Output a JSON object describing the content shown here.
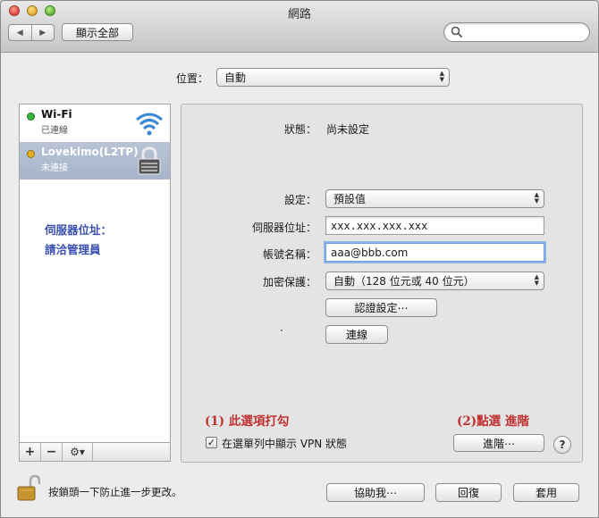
{
  "window": {
    "title": "網路"
  },
  "toolbar": {
    "back_glyph": "◀",
    "forward_glyph": "▶",
    "show_all_label": "顯示全部",
    "search_placeholder": ""
  },
  "location": {
    "label": "位置：",
    "value": "自動"
  },
  "services": [
    {
      "name": "Wi-Fi",
      "status": "已連線",
      "status_color": "#3cb43c",
      "icon": "wifi-icon"
    },
    {
      "name": "Lovekimo(L2TP)",
      "status": "未連接",
      "status_color": "#e0b020",
      "icon": "vpn-lock-icon",
      "selected": true
    }
  ],
  "sidebar_note": {
    "line1": "伺服器位址：",
    "line2": "請洽管理員"
  },
  "sidebar_toolbar": {
    "add": "+",
    "remove": "−",
    "gear": "⚙▾"
  },
  "detail": {
    "status_label": "狀態：",
    "status_value": "尚未設定",
    "config_label": "設定：",
    "config_value": "預設值",
    "server_label": "伺服器位址：",
    "server_value": "xxx.xxx.xxx.xxx",
    "account_label": "帳號名稱：",
    "account_value": "aaa@bbb.com",
    "encryption_label": "加密保護：",
    "encryption_value": "自動（128 位元或 40 位元）",
    "auth_button": "認證設定⋯",
    "connect_button": "連線",
    "dot_mark": "·",
    "annotation1": "(1) 此選項打勾",
    "annotation2": "(2)點選 進階",
    "show_vpn_checked": "✓",
    "show_vpn_label": "在選單列中顯示 VPN 狀態",
    "advanced_button": "進階⋯",
    "help_glyph": "?"
  },
  "bottom": {
    "lock_text": "按鎖頭一下防止進一步更改。",
    "assist_button": "協助我⋯",
    "revert_button": "回復",
    "apply_button": "套用"
  },
  "colors": {
    "selected_row": "#a7b4c9",
    "annotation_red": "#c03030",
    "note_blue": "#3a4fb0"
  }
}
